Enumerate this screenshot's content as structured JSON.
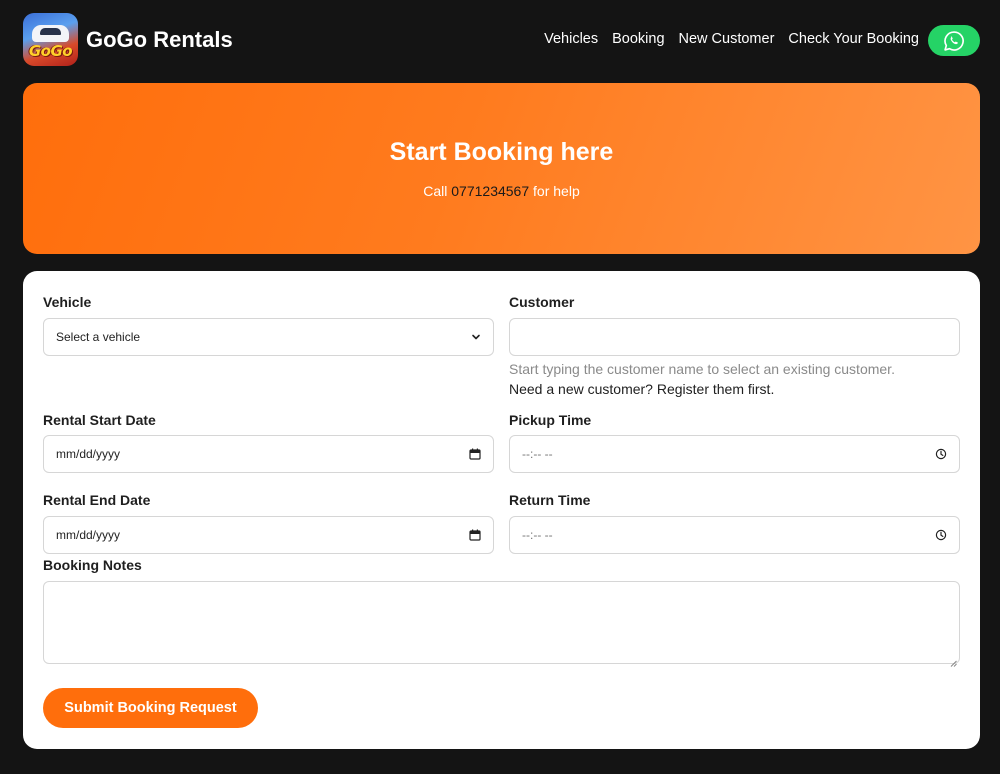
{
  "brand": {
    "logo_text": "GoGo",
    "name": "GoGo Rentals"
  },
  "nav": {
    "items": [
      {
        "label": "Vehicles"
      },
      {
        "label": "Booking"
      },
      {
        "label": "New Customer"
      },
      {
        "label": "Check Your Booking"
      }
    ],
    "whatsapp_icon": "whatsapp-icon",
    "whatsapp_color": "#25d366"
  },
  "hero": {
    "title": "Start Booking here",
    "call_prefix": "Call",
    "phone": "0771234567",
    "call_suffix": "for help",
    "accent_color": "#ff6e0c"
  },
  "form": {
    "vehicle": {
      "label": "Vehicle",
      "selected": "Select a vehicle"
    },
    "customer": {
      "label": "Customer",
      "value": "",
      "help": "Start typing the customer name to select an existing customer.",
      "register_text": "Need a new customer? Register them first."
    },
    "rental_start": {
      "label": "Rental Start Date",
      "value": "mm/dd/yyyy"
    },
    "pickup_time": {
      "label": "Pickup Time",
      "value": "--:-- --"
    },
    "rental_end": {
      "label": "Rental End Date",
      "value": "mm/dd/yyyy"
    },
    "return_time": {
      "label": "Return Time",
      "value": "--:-- --"
    },
    "notes": {
      "label": "Booking Notes",
      "value": ""
    },
    "submit_label": "Submit Booking Request"
  }
}
